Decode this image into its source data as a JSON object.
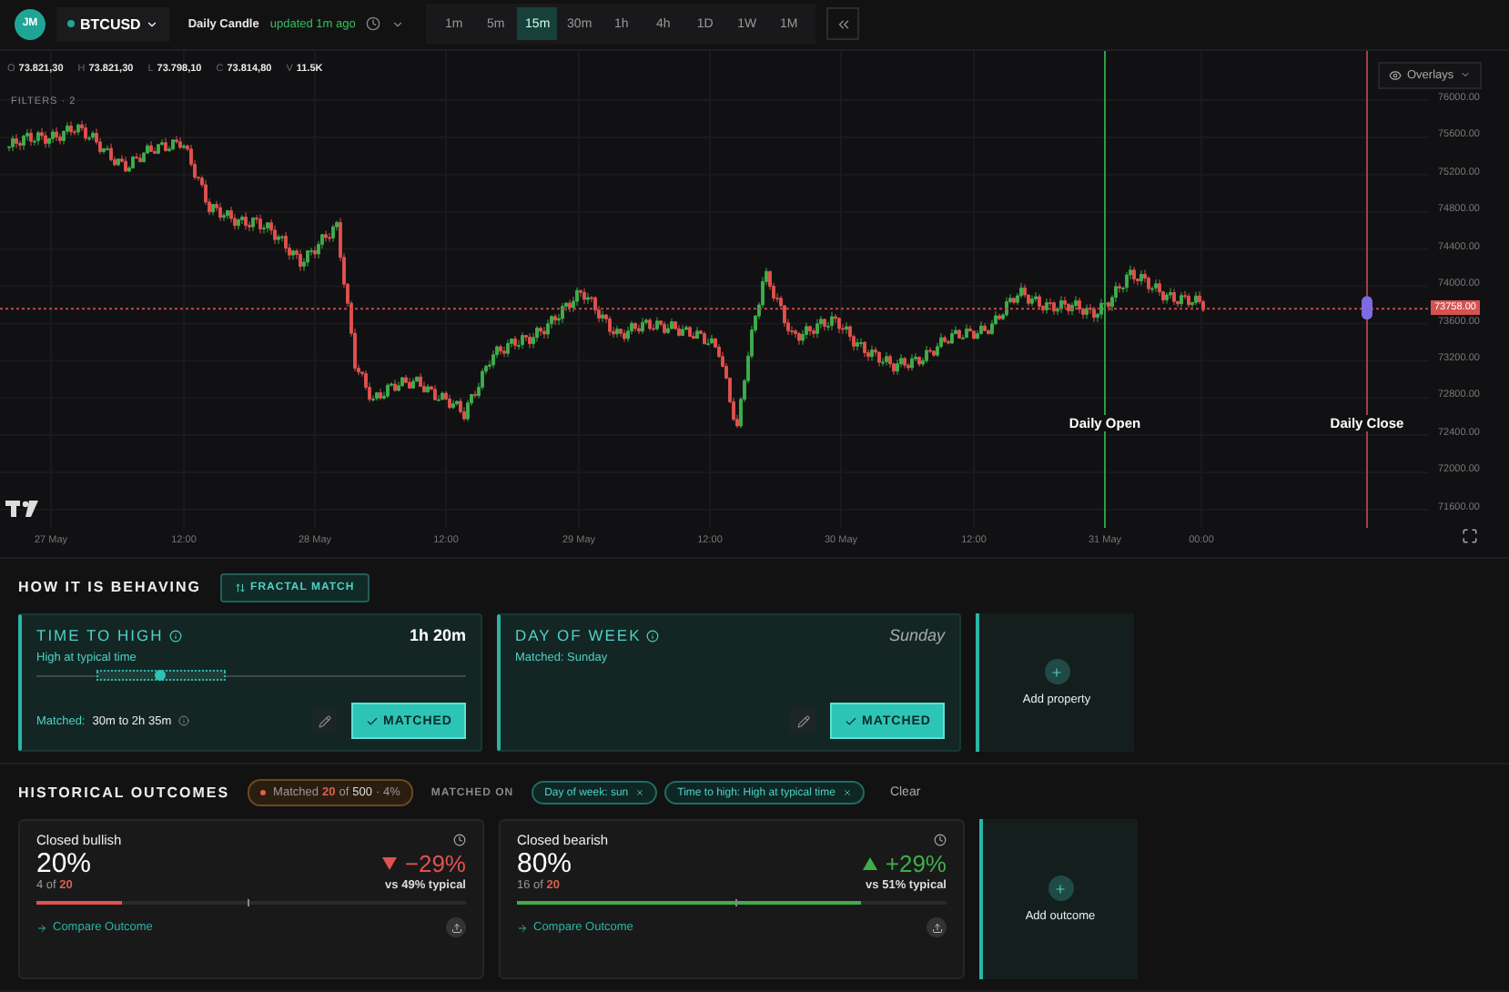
{
  "header": {
    "avatar": "JM",
    "symbol": "BTCUSD",
    "candle_label": "Daily Candle",
    "updated": "updated 1m ago"
  },
  "timeframes": [
    {
      "label": "1m",
      "selected": false
    },
    {
      "label": "5m",
      "selected": false
    },
    {
      "label": "15m",
      "selected": true
    },
    {
      "label": "30m",
      "selected": false
    },
    {
      "label": "1h",
      "selected": false
    },
    {
      "label": "4h",
      "selected": false
    },
    {
      "label": "1D",
      "selected": false
    },
    {
      "label": "1W",
      "selected": false
    },
    {
      "label": "1M",
      "selected": false
    }
  ],
  "ohlc": [
    {
      "key": "O",
      "value": "73.821,30"
    },
    {
      "key": "H",
      "value": "73.821,30"
    },
    {
      "key": "L",
      "value": "73.798,10"
    },
    {
      "key": "C",
      "value": "73.814,80"
    },
    {
      "key": "V",
      "value": "11.5K"
    }
  ],
  "chart": {
    "filters": "FILTERS · 2",
    "overlays": "Overlays",
    "price_tag": "73758.00",
    "y_ticks": [
      "76000.00",
      "75600.00",
      "75200.00",
      "74800.00",
      "74400.00",
      "74000.00",
      "73600.00",
      "73200.00",
      "72800.00",
      "72400.00",
      "72000.00",
      "71600.00"
    ],
    "x_labels": [
      "27 May",
      "12:00",
      "28 May",
      "12:00",
      "29 May",
      "12:00",
      "30 May",
      "12:00",
      "31 May",
      "00:00"
    ],
    "markers": [
      {
        "kind": "open",
        "label": "Daily Open"
      },
      {
        "kind": "close",
        "label": "Daily Close"
      }
    ]
  },
  "behaving": {
    "title": "HOW IT IS BEHAVING",
    "fractal_button": "FRACTAL MATCH",
    "cards": [
      {
        "kind": "slider",
        "title": "TIME TO HIGH",
        "value": "1h 20m",
        "subtitle": "High at typical time",
        "level": 0.29,
        "matched_label": "Matched:",
        "matched_value": "30m to 2h 35m",
        "button": "MATCHED"
      },
      {
        "kind": "text",
        "title": "DAY OF WEEK",
        "value": "Sunday",
        "subtitle": "Matched: Sunday",
        "button": "MATCHED"
      }
    ],
    "add_label": "Add property"
  },
  "outcomes": {
    "title": "HISTORICAL OUTCOMES",
    "badge": {
      "pre": "Matched",
      "count": "20",
      "of": "of",
      "total": "500",
      "share": "· 4%"
    },
    "matched_on_label": "MATCHED ON",
    "chips": [
      "Day of week: sun",
      "Time to high: High at typical time"
    ],
    "clear": "Clear",
    "cards": [
      {
        "kind": "down",
        "name": "Closed bullish",
        "percent": "20%",
        "delta": "−29%",
        "count": "4 of",
        "total": "20",
        "typical": "vs 49% typical",
        "level": 0.2,
        "typical_marker": {
          "level": 0.49
        },
        "link": "Compare Outcome"
      },
      {
        "kind": "up",
        "name": "Closed bearish",
        "percent": "80%",
        "delta": "+29%",
        "count": "16 of",
        "total": "20",
        "typical": "vs 51% typical",
        "level": 0.8,
        "typical_marker": {
          "level": 0.51
        },
        "link": "Compare Outcome"
      }
    ],
    "add_label": "Add outcome"
  }
}
